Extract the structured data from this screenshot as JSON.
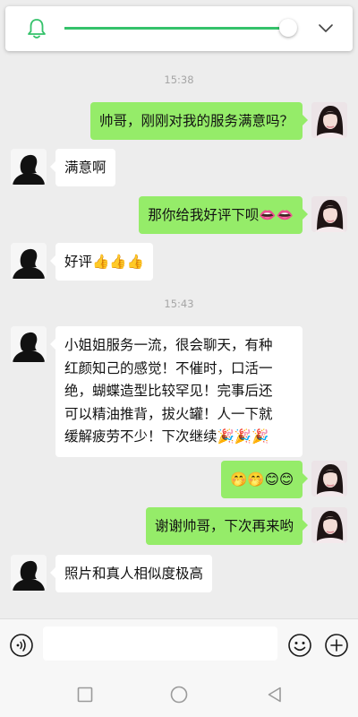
{
  "messages": [
    {
      "type": "time",
      "text": "15:38"
    },
    {
      "type": "sent",
      "text": "帅哥，刚刚对我的服务满意吗？"
    },
    {
      "type": "received",
      "text": "满意啊"
    },
    {
      "type": "sent",
      "text": "那你给我好评下呗",
      "emoji": "👄👄"
    },
    {
      "type": "received",
      "text": "好评",
      "emoji": "👍👍👍"
    },
    {
      "type": "time",
      "text": "15:43"
    },
    {
      "type": "received",
      "lines": [
        "小姐姐服务一流，很会聊天，有种",
        "红颜知己的感觉！不催时，口活一",
        "绝，蝴蝶造型比较罕见！完事后还",
        "可以精油推背，拔火罐！人一下就",
        "缓解疲劳不少！下次继续"
      ],
      "emoji": "🎉🎉🎉"
    },
    {
      "type": "sent",
      "emoji": "🤭🤭😊😊"
    },
    {
      "type": "sent",
      "text": "谢谢帅哥，下次再来哟"
    },
    {
      "type": "received",
      "text": "照片和真人相似度极高"
    }
  ],
  "volume": {
    "level": 0.96,
    "accent": "#35c26b"
  },
  "input": {
    "value": ""
  },
  "colors": {
    "sent_bubble": "#95ec69",
    "received_bubble": "#ffffff",
    "background": "#ededed"
  },
  "icons": [
    "bell-icon",
    "chevron-down-icon",
    "voice-icon",
    "emoji-icon",
    "plus-icon",
    "recent-apps-icon",
    "home-icon",
    "back-icon"
  ]
}
